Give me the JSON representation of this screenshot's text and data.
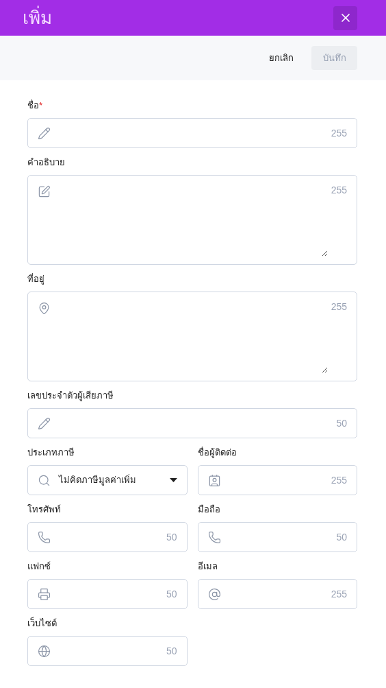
{
  "header": {
    "title": "เพิ่ม"
  },
  "toolbar": {
    "cancel": "ยกเลิก",
    "save": {
      "label": "บันทึก",
      "disabled": true
    }
  },
  "rows": [
    [
      {
        "kind": "text",
        "label": "ชื่อ",
        "required_mark": "*",
        "counter": "255"
      }
    ],
    [
      {
        "kind": "textarea",
        "label": "คำอธิบาย",
        "counter": "255"
      }
    ],
    [
      {
        "kind": "textarea",
        "label": "ที่อยู่",
        "counter": "255"
      }
    ],
    [
      {
        "kind": "text",
        "label": "เลขประจำตัวผู้เสียภาษี",
        "counter": "50"
      }
    ],
    [
      {
        "kind": "select",
        "label": "ประเภทภาษี",
        "value": "ไม่คิดภาษีมูลค่าเพิ่ม"
      },
      {
        "kind": "text",
        "label": "ชื่อผู้ติดต่อ",
        "counter": "255"
      }
    ],
    [
      {
        "kind": "text",
        "label": "โทรศัพท์",
        "counter": "50"
      },
      {
        "kind": "text",
        "label": "มือถือ",
        "counter": "50"
      }
    ],
    [
      {
        "kind": "text",
        "label": "แฟกซ์",
        "counter": "50"
      },
      {
        "kind": "text",
        "label": "อีเมล",
        "counter": "255"
      }
    ],
    [
      {
        "kind": "text",
        "label": "เว็บไซต์",
        "counter": "50"
      }
    ]
  ]
}
